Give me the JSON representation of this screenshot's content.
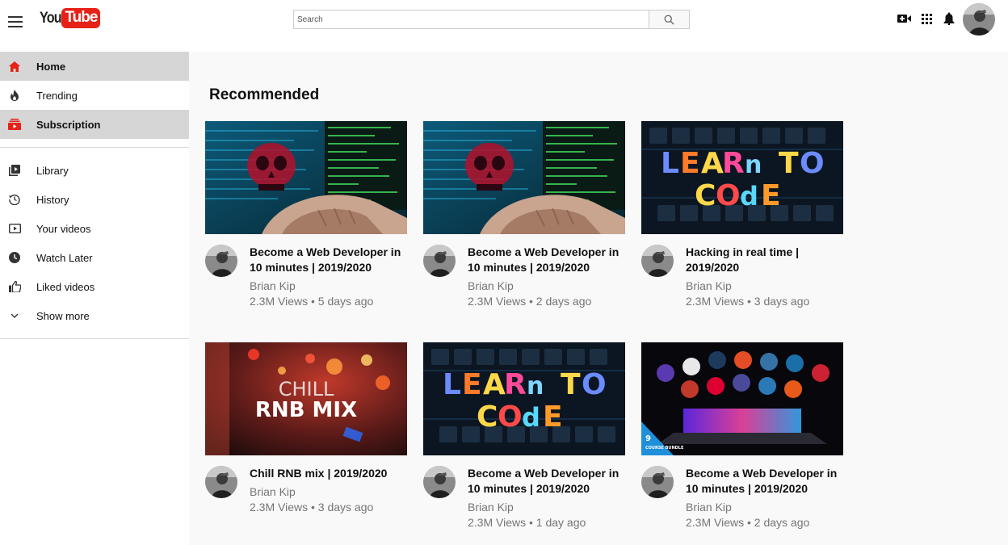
{
  "header": {
    "logo_you": "You",
    "logo_tube": "Tube",
    "search_placeholder": "Search",
    "icons": [
      "menu-icon",
      "search-icon",
      "create-video-icon",
      "apps-grid-icon",
      "notifications-bell-icon",
      "account-avatar"
    ]
  },
  "sidebar": {
    "primary": [
      {
        "label": "Home",
        "icon": "home-icon"
      },
      {
        "label": "Trending",
        "icon": "flame-icon"
      },
      {
        "label": "Subscription",
        "icon": "subscriptions-icon"
      }
    ],
    "secondary": [
      {
        "label": "Library",
        "icon": "library-icon"
      },
      {
        "label": "History",
        "icon": "history-icon"
      },
      {
        "label": "Your videos",
        "icon": "your-videos-icon"
      },
      {
        "label": "Watch Later",
        "icon": "clock-icon"
      },
      {
        "label": "Liked videos",
        "icon": "thumbs-up-icon"
      },
      {
        "label": "Show more",
        "icon": "chevron-down-icon"
      }
    ]
  },
  "main": {
    "section_title": "Recommended",
    "videos": [
      {
        "title": "Become a Web Developer in 10 minutes | 2019/2020",
        "channel": "Brian Kip",
        "stats": "2.3M Views • 5 days ago",
        "thumb": "hacker"
      },
      {
        "title": "Become a Web Developer in 10 minutes | 2019/2020",
        "channel": "Brian Kip",
        "stats": "2.3M Views • 2 days ago",
        "thumb": "hacker"
      },
      {
        "title": "Hacking in real time | 2019/2020",
        "channel": "Brian Kip",
        "stats": "2.3M Views • 3 days ago",
        "thumb": "learn"
      },
      {
        "title": "Chill RNB mix | 2019/2020",
        "channel": "Brian Kip",
        "stats": "2.3M Views • 3 days ago",
        "thumb": "rnb",
        "thumb_text_1": "CHILL",
        "thumb_text_2": "RNB MIX"
      },
      {
        "title": "Become a Web Developer in 10 minutes | 2019/2020",
        "channel": "Brian Kip",
        "stats": "2.3M Views • 1 day ago",
        "thumb": "learn"
      },
      {
        "title": "Become a Web Developer in 10 minutes | 2019/2020",
        "channel": "Brian Kip",
        "stats": "2.3M Views • 2 days ago",
        "thumb": "laptop",
        "thumb_badge": "9",
        "thumb_badge_sub": "COURSE BUNDLE"
      }
    ]
  },
  "colors": {
    "brand_red": "#e62117",
    "active_nav": "#d6d6d6",
    "main_bg": "#f9f9f9",
    "meta_text": "#757575"
  }
}
